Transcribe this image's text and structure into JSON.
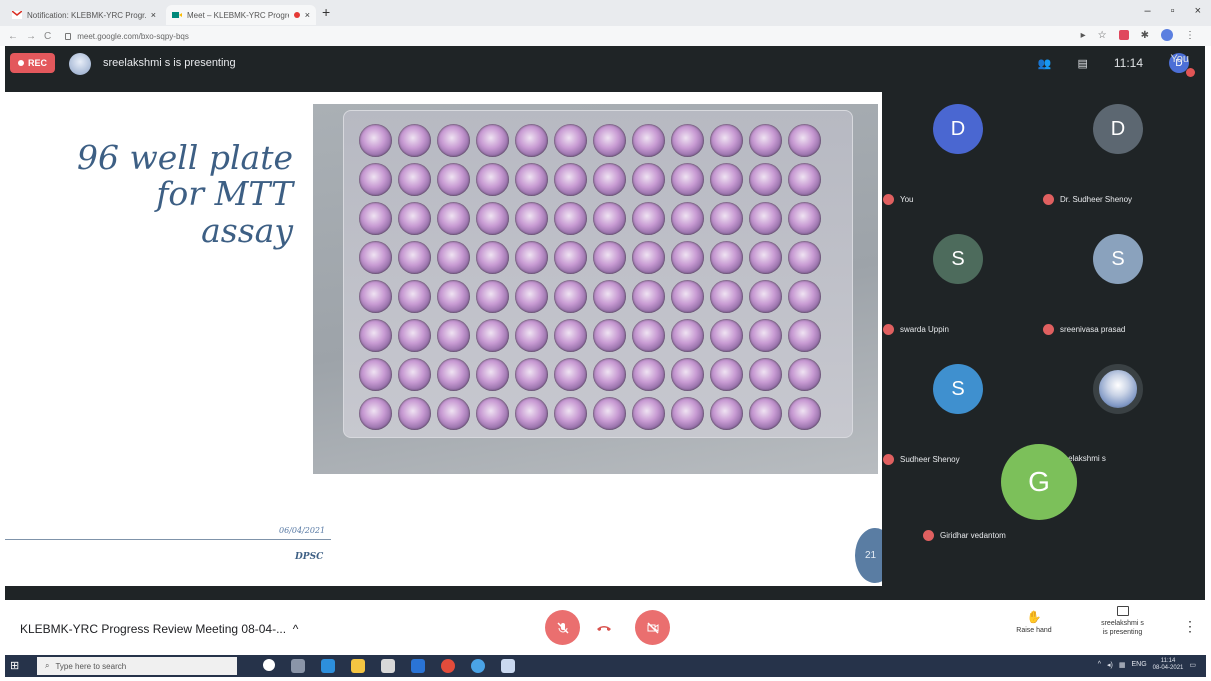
{
  "browser": {
    "tabs": [
      {
        "label": "Notification: KLEBMK-YRC Progr...",
        "active": false
      },
      {
        "label": "Meet – KLEBMK-YRC Progre...",
        "active": true
      }
    ],
    "url": "meet.google.com/bxo-sqpy-bqs"
  },
  "meet": {
    "rec_label": "REC",
    "presenting_text": "sreelakshmi s is presenting",
    "clock": "11:14",
    "you_label": "You",
    "you_initial": "D"
  },
  "slide": {
    "title_lines": [
      "96 well plate",
      "for MTT",
      "assay"
    ],
    "date": "06/04/2021",
    "footer": "DPSC",
    "page_number": "21",
    "plate_rows": 8,
    "plate_cols": 12
  },
  "participants": [
    {
      "initial": "D",
      "name": "You",
      "color": "#4a67d1",
      "muted": true
    },
    {
      "initial": "D",
      "name": "Dr. Sudheer Shenoy",
      "color": "#5c6771",
      "muted": true
    },
    {
      "initial": "S",
      "name": "swarda Uppin",
      "color": "#4d6b5c",
      "muted": true
    },
    {
      "initial": "S",
      "name": "sreenivasa prasad",
      "color": "#8aa2bd",
      "muted": true
    },
    {
      "initial": "S",
      "name": "Sudheer Shenoy",
      "color": "#3f90cf",
      "muted": true
    },
    {
      "initial": "",
      "name": "sreelakshmi s",
      "color": "#c9d1dc",
      "muted": false
    },
    {
      "initial": "G",
      "name": "Giridhar vedantom",
      "color": "#7cc05a",
      "muted": true
    }
  ],
  "bottom": {
    "meeting_title": "KLEBMK-YRC Progress Review Meeting 08-04-...",
    "raise_hand": "Raise hand",
    "presenting_line1": "sreelakshmi s",
    "presenting_line2": "is presenting"
  },
  "taskbar": {
    "search_placeholder": "Type here to search",
    "lang": "ENG",
    "time": "11:14",
    "date": "08-04-2021"
  }
}
